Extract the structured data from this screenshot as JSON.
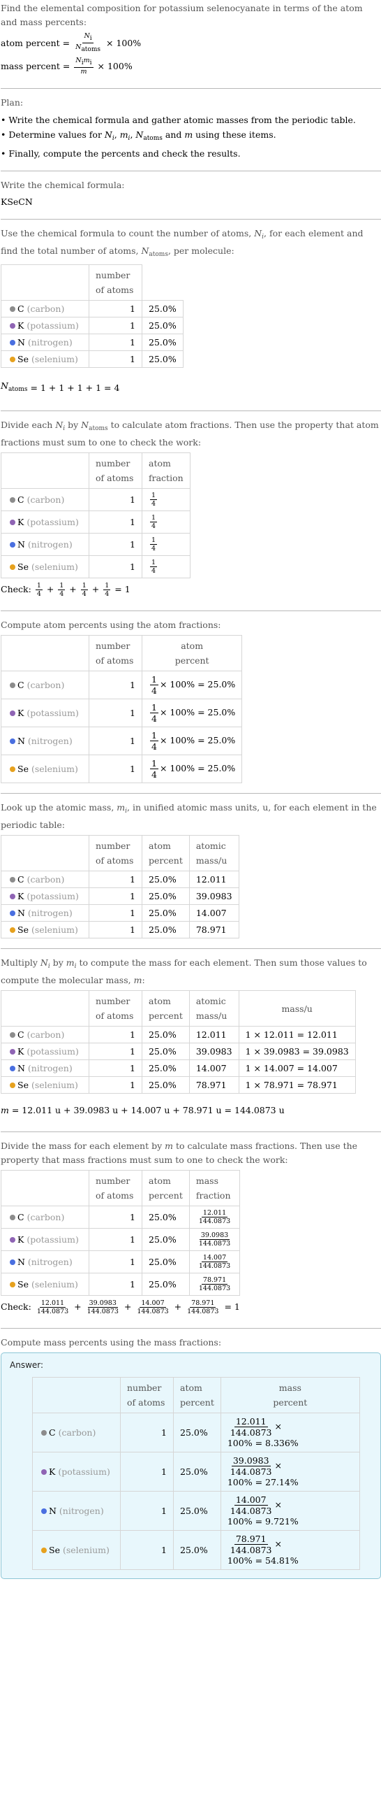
{
  "intro": {
    "question": "Find the elemental composition for potassium selenocyanate in terms of the atom and mass percents:",
    "atom_percent_label": "atom percent =",
    "mass_percent_label": "mass percent =",
    "times_100": "× 100%"
  },
  "plan": {
    "title": "Plan:",
    "items": [
      "Write the chemical formula and gather atomic masses from the periodic table.",
      "Determine values for N_i, m_i, N_atoms and m using these items.",
      "Finally, compute the percents and check the results."
    ]
  },
  "formula_step": {
    "intro": "Write the chemical formula:",
    "formula": "KSeCN"
  },
  "elements": [
    {
      "symbol": "C",
      "name": "(carbon)",
      "color": "#8c8c8c",
      "count": "1",
      "atom_fraction_num": "1",
      "atom_fraction_den": "4",
      "atom_percent": "25.0%",
      "atomic_mass": "12.011",
      "mass_calc": "1 × 12.011 = 12.011",
      "mass_fraction_num": "12.011",
      "mass_fraction_den": "144.0873",
      "mass_percent_result": "100% = 8.336%"
    },
    {
      "symbol": "K",
      "name": "(potassium)",
      "color": "#8f64b4",
      "count": "1",
      "atom_fraction_num": "1",
      "atom_fraction_den": "4",
      "atom_percent": "25.0%",
      "atomic_mass": "39.0983",
      "mass_calc": "1 × 39.0983 = 39.0983",
      "mass_fraction_num": "39.0983",
      "mass_fraction_den": "144.0873",
      "mass_percent_result": "100% = 27.14%"
    },
    {
      "symbol": "N",
      "name": "(nitrogen)",
      "color": "#4a6fe0",
      "count": "1",
      "atom_fraction_num": "1",
      "atom_fraction_den": "4",
      "atom_percent": "25.0%",
      "atomic_mass": "14.007",
      "mass_calc": "1 × 14.007 = 14.007",
      "mass_fraction_num": "14.007",
      "mass_fraction_den": "144.0873",
      "mass_percent_result": "100% = 9.721%"
    },
    {
      "symbol": "Se",
      "name": "(selenium)",
      "color": "#e6a11e",
      "count": "1",
      "atom_fraction_num": "1",
      "atom_fraction_den": "4",
      "atom_percent": "25.0%",
      "atomic_mass": "78.971",
      "mass_calc": "1 × 78.971 = 78.971",
      "mass_fraction_num": "78.971",
      "mass_fraction_den": "144.0873",
      "mass_percent_result": "100% = 54.81%"
    }
  ],
  "headers": {
    "number_of_atoms": [
      "number",
      "of atoms"
    ],
    "atom_fraction": [
      "atom",
      "fraction"
    ],
    "atom_percent": [
      "atom",
      "percent"
    ],
    "atomic_mass": [
      "atomic",
      "mass/u"
    ],
    "mass": "mass/u",
    "mass_fraction": [
      "mass",
      "fraction"
    ],
    "mass_percent": [
      "mass",
      "percent"
    ]
  },
  "count_step": {
    "intro": "Use the chemical formula to count the number of atoms, N_i, for each element and find the total number of atoms, N_atoms, per molecule:",
    "total": "= 1 + 1 + 1 + 1 = 4"
  },
  "fraction_step": {
    "intro": "Divide each N_i by N_atoms to calculate atom fractions. Then use the property that atom fractions must sum to one to check the work:",
    "check_label": "Check:",
    "check_result": "= 1"
  },
  "atom_percent_step": {
    "intro": "Compute atom percents using the atom fractions:",
    "result": "× 100% = 25.0%"
  },
  "mass_lookup_step": {
    "intro": "Look up the atomic mass, m_i, in unified atomic mass units, u, for each element in the periodic table:"
  },
  "mass_step": {
    "intro": "Multiply N_i by m_i to compute the mass for each element. Then sum those values to compute the molecular mass, m:",
    "total": "= 12.011 u + 39.0983 u + 14.007 u + 78.971 u = 144.0873 u"
  },
  "mass_fraction_step": {
    "intro": "Divide the mass for each element by m to calculate mass fractions. Then use the property that mass fractions must sum to one to check the work:",
    "check_label": "Check:",
    "check_result": "= 1"
  },
  "mass_percent_step": {
    "intro": "Compute mass percents using the mass fractions:",
    "answer_label": "Answer:",
    "times": "×"
  }
}
